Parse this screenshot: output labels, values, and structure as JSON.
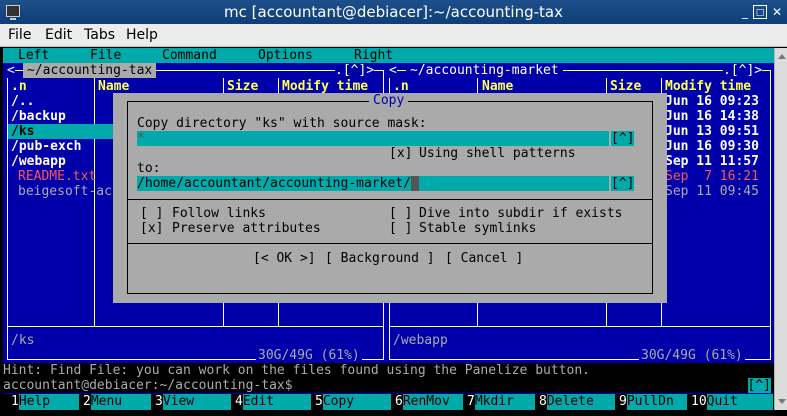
{
  "window": {
    "title": "mc [accountant@debiacer]:~/accounting-tax",
    "min_label": "_",
    "max_label": "□",
    "close_label": "✕"
  },
  "menubar": {
    "file": "File",
    "edit": "Edit",
    "tabs": "Tabs",
    "help": "Help"
  },
  "mc_menu": {
    "left": "Left",
    "file": "File",
    "command": "Command",
    "options": "Options",
    "right": "Right"
  },
  "left_panel": {
    "title": "~/accounting-tax",
    "corner_left": "<",
    "corner_buttons": ".[^]>",
    "headers": {
      "n": ".n",
      "name": "Name",
      "size": "Size",
      "mtime": "Modify time"
    },
    "entries": [
      {
        "name": "/..",
        "type": "dir"
      },
      {
        "name": "/backup",
        "type": "dir"
      },
      {
        "name": "/ks",
        "type": "dir",
        "selected": true
      },
      {
        "name": "/pub-exch",
        "type": "dir"
      },
      {
        "name": "/webapp",
        "type": "dir"
      },
      {
        "name": "README.txt",
        "type": "readme"
      },
      {
        "name": "beigesoft-ac",
        "type": "file"
      }
    ],
    "mini_status": "/ks",
    "disk_info": "30G/49G (61%)"
  },
  "right_panel": {
    "title": "~/accounting-market",
    "corner_left": "<",
    "corner_buttons": ".[^]>",
    "headers": {
      "n": ".n",
      "name": "Name",
      "size": "Size",
      "mtime": "Modify time"
    },
    "mtimes": [
      {
        "text": "Jun 16 09:23",
        "style": "dir"
      },
      {
        "text": "Jun 16 14:38",
        "style": "dir"
      },
      {
        "text": "Jun 13 09:51",
        "style": "dir"
      },
      {
        "text": "Jun 16 09:30",
        "style": "dir"
      },
      {
        "text": "Sep 11 11:57",
        "style": "dir"
      },
      {
        "text": "Sep  7 16:21",
        "style": "readme"
      },
      {
        "text": "Sep 11 09:45",
        "style": "file"
      }
    ],
    "mini_status": "/webapp",
    "disk_info": "30G/49G (61%)"
  },
  "dialog": {
    "title": "Copy",
    "prompt": "Copy directory \"ks\" with source mask:",
    "mask_value": "*",
    "hist_button": "[^]",
    "shell_patterns_check": "[x]",
    "shell_patterns_label": "Using shell patterns",
    "to_label": "to:",
    "dest_value": "/home/accountant/accounting-market/",
    "follow_links_check": "[ ]",
    "follow_links_label": "Follow links",
    "preserve_attrs_check": "[x]",
    "preserve_attrs_label": "Preserve attributes",
    "dive_subdir_check": "[ ]",
    "dive_subdir_label": "Dive into subdir if exists",
    "stable_symlinks_check": "[ ]",
    "stable_symlinks_label": "Stable symlinks",
    "ok_button": "[< OK >]",
    "background_button": "[ Background ]",
    "cancel_button": "[ Cancel ]"
  },
  "hint": "Hint: Find File: you can work on the files found using the Panelize button.",
  "cmdline": {
    "prompt": "accountant@debiacer:~/accounting-tax$",
    "hist_button": "[^]"
  },
  "fkeys": [
    {
      "num": "1",
      "label": "Help"
    },
    {
      "num": "2",
      "label": "Menu"
    },
    {
      "num": "3",
      "label": "View"
    },
    {
      "num": "4",
      "label": "Edit"
    },
    {
      "num": "5",
      "label": "Copy"
    },
    {
      "num": "6",
      "label": "RenMov"
    },
    {
      "num": "7",
      "label": "Mkdir"
    },
    {
      "num": "8",
      "label": "Delete"
    },
    {
      "num": "9",
      "label": "PullDn"
    },
    {
      "num": "10",
      "label": "Quit"
    }
  ]
}
